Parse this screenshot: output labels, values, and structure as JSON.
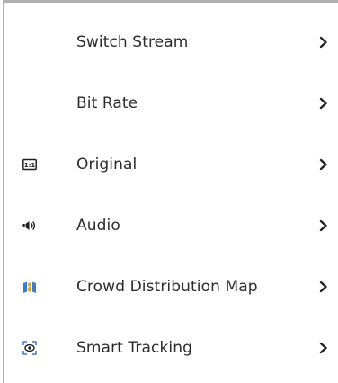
{
  "menu": {
    "items": [
      {
        "label": "Switch Stream",
        "icon": "none"
      },
      {
        "label": "Bit Rate",
        "icon": "none"
      },
      {
        "label": "Original",
        "icon": "original-ratio-icon"
      },
      {
        "label": "Audio",
        "icon": "speaker-icon"
      },
      {
        "label": "Crowd Distribution Map",
        "icon": "crowd-map-icon"
      },
      {
        "label": "Smart Tracking",
        "icon": "smart-tracking-icon"
      }
    ]
  },
  "colors": {
    "text": "#2b2b2b",
    "icon_dark": "#1f1f1f",
    "icon_blue": "#3a7bd5",
    "border": "#b0b0b0"
  }
}
